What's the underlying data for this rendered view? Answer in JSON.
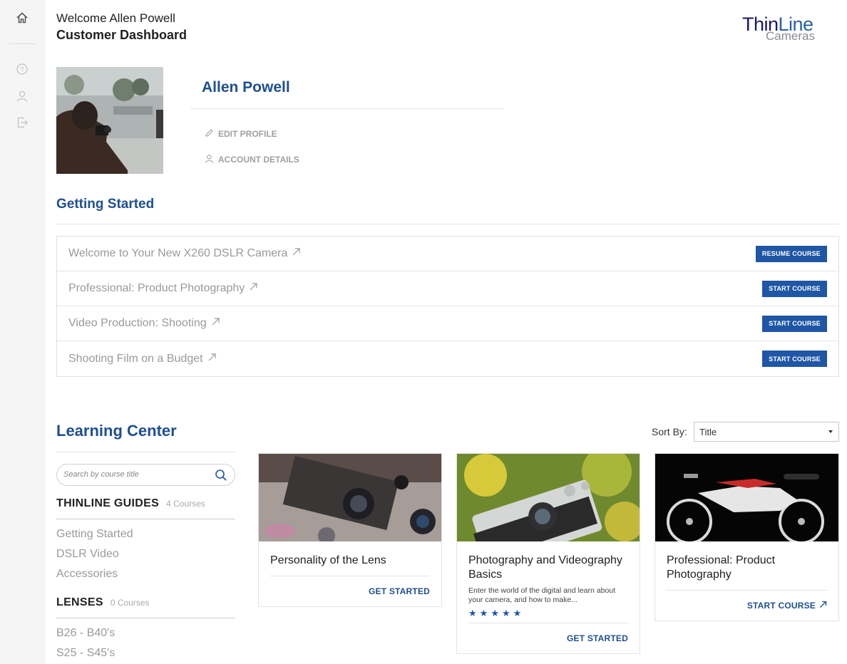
{
  "header": {
    "welcome": "Welcome Allen Powell",
    "title": "Customer Dashboard",
    "logo_top_a": "Thin",
    "logo_top_b": "Line",
    "logo_bottom": "Cameras"
  },
  "sidebar": {
    "icons": [
      "home-icon",
      "help-icon",
      "user-icon",
      "logout-icon"
    ]
  },
  "profile": {
    "name": "Allen Powell",
    "edit_profile": "EDIT PROFILE",
    "account_details": "ACCOUNT DETAILS"
  },
  "getting_started": {
    "title": "Getting Started",
    "courses": [
      {
        "title": "Welcome to Your New X260 DSLR Camera",
        "action": "RESUME COURSE"
      },
      {
        "title": "Professional: Product Photography",
        "action": "START COURSE"
      },
      {
        "title": "Video Production: Shooting",
        "action": "START COURSE"
      },
      {
        "title": "Shooting Film on a Budget",
        "action": "START COURSE"
      }
    ]
  },
  "learning_center": {
    "title": "Learning Center",
    "sort_label": "Sort By:",
    "sort_value": "Title",
    "search_placeholder": "Search by course title",
    "categories": [
      {
        "title": "THINLINE GUIDES",
        "count": "4 Courses",
        "items": [
          "Getting Started",
          "DSLR Video",
          "Accessories"
        ]
      },
      {
        "title": "LENSES",
        "count": "0 Courses",
        "items": [
          "B26 - B40's",
          "S25 - S45's"
        ]
      }
    ],
    "cards": [
      {
        "title": "Personality of the Lens",
        "description": "",
        "rating": 0,
        "action": "GET STARTED"
      },
      {
        "title": "Photography and Videography Basics",
        "description": "Enter the world of the digital and learn about your camera, and how to make...",
        "rating": 5,
        "action": "GET STARTED"
      },
      {
        "title": "Professional: Product Photography",
        "description": "",
        "rating": 0,
        "action": "START COURSE"
      }
    ]
  },
  "colors": {
    "accent": "#1f4f91",
    "button": "#1f56a5",
    "muted_text": "#9a9a9a"
  }
}
